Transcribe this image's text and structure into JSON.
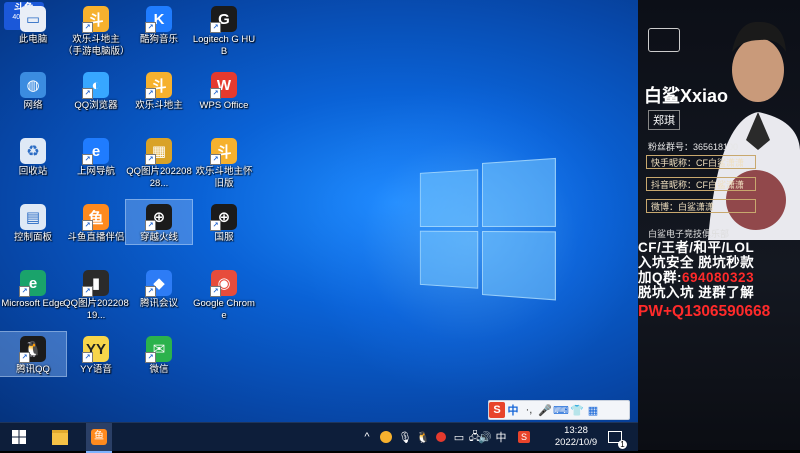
{
  "overlay": {
    "logo_text": "斗鱼",
    "logo_sub": "401445"
  },
  "desktop_icons": [
    {
      "label": "此电脑",
      "icon": "computer-icon",
      "color": "#e9eef7",
      "glyph": "▭"
    },
    {
      "label": "欢乐斗地主（手游电脑版）",
      "icon": "landlord-game-icon",
      "color": "#f6b12e",
      "glyph": "斗"
    },
    {
      "label": "酷狗音乐",
      "icon": "kugou-music-icon",
      "color": "#1f7cff",
      "glyph": "K"
    },
    {
      "label": "Logitech G HUB",
      "icon": "logitech-ghub-icon",
      "color": "#1b1b1b",
      "glyph": "G"
    },
    {
      "label": "网络",
      "icon": "network-icon",
      "color": "#3b8ce0",
      "glyph": "◍"
    },
    {
      "label": "QQ浏览器",
      "icon": "qq-browser-icon",
      "color": "#37a7ff",
      "glyph": "◐"
    },
    {
      "label": "欢乐斗地主",
      "icon": "landlord-game-icon",
      "color": "#f6b12e",
      "glyph": "斗"
    },
    {
      "label": "WPS Office",
      "icon": "wps-office-icon",
      "color": "#e53a2e",
      "glyph": "W"
    },
    {
      "label": "回收站",
      "icon": "recycle-bin-icon",
      "color": "#dfe9f6",
      "glyph": "♻"
    },
    {
      "label": "上网导航",
      "icon": "web-nav-icon",
      "color": "#1f7cff",
      "glyph": "e"
    },
    {
      "label": "QQ图片20220828...",
      "icon": "image-file-icon",
      "color": "#d9a227",
      "glyph": "▦"
    },
    {
      "label": "欢乐斗地主怀旧版",
      "icon": "landlord-game-icon",
      "color": "#f6b12e",
      "glyph": "斗"
    },
    {
      "label": "控制面板",
      "icon": "control-panel-icon",
      "color": "#dfe9f6",
      "glyph": "▤"
    },
    {
      "label": "斗鱼直播伴侣",
      "icon": "douyu-companion-icon",
      "color": "#ff8a1e",
      "glyph": "鱼"
    },
    {
      "label": "穿越火线",
      "icon": "crossfire-icon",
      "color": "#1b1b1b",
      "glyph": "⊕"
    },
    {
      "label": "国服",
      "icon": "crossfire-icon",
      "color": "#1b1b1b",
      "glyph": "⊕"
    },
    {
      "label": "Microsoft Edge",
      "icon": "edge-icon",
      "color": "#1aa36b",
      "glyph": "e"
    },
    {
      "label": "QQ图片20220819...",
      "icon": "image-file-icon",
      "color": "#2b2b2b",
      "glyph": "▮"
    },
    {
      "label": "腾讯会议",
      "icon": "tencent-meeting-icon",
      "color": "#2d7cf6",
      "glyph": "◆"
    },
    {
      "label": "Google Chrome",
      "icon": "chrome-icon",
      "color": "#e74c3c",
      "glyph": "◉"
    },
    {
      "label": "腾讯QQ",
      "icon": "qq-icon",
      "color": "#1b1b1b",
      "glyph": "🐧"
    },
    {
      "label": "YY语音",
      "icon": "yy-voice-icon",
      "color": "#f7d54a",
      "glyph": "YY"
    },
    {
      "label": "微信",
      "icon": "wechat-icon",
      "color": "#2bb24c",
      "glyph": "✉"
    }
  ],
  "taskbar": {
    "time": "13:28",
    "date": "2022/10/9",
    "ime_label": "中",
    "notification_count": "1"
  },
  "ime_bar": {
    "brand": "S",
    "mode": "中",
    "punct": "·,"
  },
  "panel": {
    "streamer_name": "白鲨Xxiao",
    "real_name": "郑琪",
    "fans_line": "粉丝群号：365618100",
    "kuaishou": "快手昵称：CF白鲨潇潇",
    "douyin": "抖音昵称：CF白鲨潇潇",
    "weibo": "微博：白鲨潇潇",
    "club": "白鲨电子竞技俱乐部",
    "promo_line1": "CF/王者/和平/LOL",
    "promo_line2": "入坑安全 脱坑秒款",
    "promo_line3_prefix": "加Q群:",
    "promo_line3_number": "694080323",
    "promo_line4": "脱坑入坑 进群了解",
    "pw_line": "PW+Q1306590668"
  },
  "colors": {
    "accent_red": "#ff2a2a",
    "taskbar_bg": "#0d1e3a"
  }
}
